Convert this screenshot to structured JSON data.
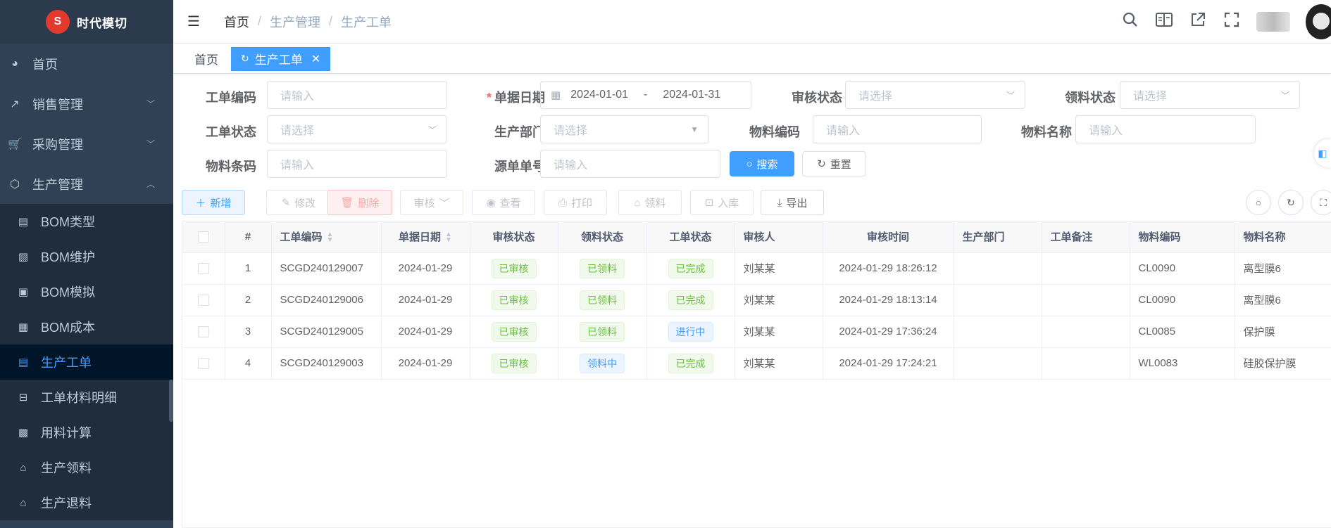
{
  "app": {
    "logo_text": "时代模切",
    "logo_mark": "S"
  },
  "sidebar": {
    "items": [
      {
        "label": "首页",
        "icon": "dashboard-icon",
        "glyph": "◕"
      },
      {
        "label": "销售管理",
        "icon": "chart-icon",
        "glyph": "↗"
      },
      {
        "label": "采购管理",
        "icon": "cart-icon",
        "glyph": "🛒"
      },
      {
        "label": "生产管理",
        "icon": "box-icon",
        "glyph": "⬡"
      }
    ],
    "sub_items": [
      {
        "label": "BOM类型",
        "glyph": "▤"
      },
      {
        "label": "BOM维护",
        "glyph": "▨"
      },
      {
        "label": "BOM模拟",
        "glyph": "▣"
      },
      {
        "label": "BOM成本",
        "glyph": "▦"
      },
      {
        "label": "生产工单",
        "glyph": "▤"
      },
      {
        "label": "工单材料明细",
        "glyph": "⊟"
      },
      {
        "label": "用料计算",
        "glyph": "▩"
      },
      {
        "label": "生产领料",
        "glyph": "⌂"
      },
      {
        "label": "生产退料",
        "glyph": "⌂"
      }
    ]
  },
  "header": {
    "breadcrumb": [
      "首页",
      "生产管理",
      "生产工单"
    ],
    "separator": "/"
  },
  "tags": {
    "home": "首页",
    "active": "生产工单"
  },
  "form": {
    "labels": {
      "order_code": "工单编码",
      "doc_date": "单据日期",
      "audit_status": "审核状态",
      "pick_status": "领料状态",
      "order_status": "工单状态",
      "prod_dept": "生产部门",
      "material_code": "物料编码",
      "material_name": "物料名称",
      "material_barcode": "物料条码",
      "source_no": "源单单号"
    },
    "required_mark": "*",
    "placeholder_input": "请输入",
    "placeholder_select": "请选择",
    "date_start": "2024-01-01",
    "date_sep": "-",
    "date_end": "2024-01-31",
    "search_btn": "搜索",
    "reset_btn": "重置"
  },
  "toolbar": {
    "add": "新增",
    "edit": "修改",
    "delete": "删除",
    "audit": "审核",
    "view": "查看",
    "print": "打印",
    "pick": "领料",
    "stock_in": "入库",
    "export": "导出"
  },
  "table": {
    "columns": [
      "#",
      "工单编码",
      "单据日期",
      "审核状态",
      "领料状态",
      "工单状态",
      "审核人",
      "审核时间",
      "生产部门",
      "工单备注",
      "物料编码",
      "物料名称"
    ],
    "rows": [
      {
        "idx": "1",
        "code": "SCGD240129007",
        "date": "2024-01-29",
        "audit": "已审核",
        "pick": "已领料",
        "status": "已完成",
        "auditor": "刘某某",
        "audit_time": "2024-01-29 18:26:12",
        "dept": "",
        "remark": "",
        "mat_code": "CL0090",
        "mat_name": "离型膜6"
      },
      {
        "idx": "2",
        "code": "SCGD240129006",
        "date": "2024-01-29",
        "audit": "已审核",
        "pick": "已领料",
        "status": "已完成",
        "auditor": "刘某某",
        "audit_time": "2024-01-29 18:13:14",
        "dept": "",
        "remark": "",
        "mat_code": "CL0090",
        "mat_name": "离型膜6"
      },
      {
        "idx": "3",
        "code": "SCGD240129005",
        "date": "2024-01-29",
        "audit": "已审核",
        "pick": "已领料",
        "status": "进行中",
        "auditor": "刘某某",
        "audit_time": "2024-01-29 17:36:24",
        "dept": "",
        "remark": "",
        "mat_code": "CL0085",
        "mat_name": "保护膜"
      },
      {
        "idx": "4",
        "code": "SCGD240129003",
        "date": "2024-01-29",
        "audit": "已审核",
        "pick": "领料中",
        "status": "已完成",
        "auditor": "刘某某",
        "audit_time": "2024-01-29 17:24:21",
        "dept": "",
        "remark": "",
        "mat_code": "WL0083",
        "mat_name": "硅胶保护膜"
      }
    ]
  },
  "colors": {
    "primary": "#409eff",
    "sidebar_bg": "#304156",
    "success": "#67c23a",
    "danger": "#f56c6c"
  }
}
